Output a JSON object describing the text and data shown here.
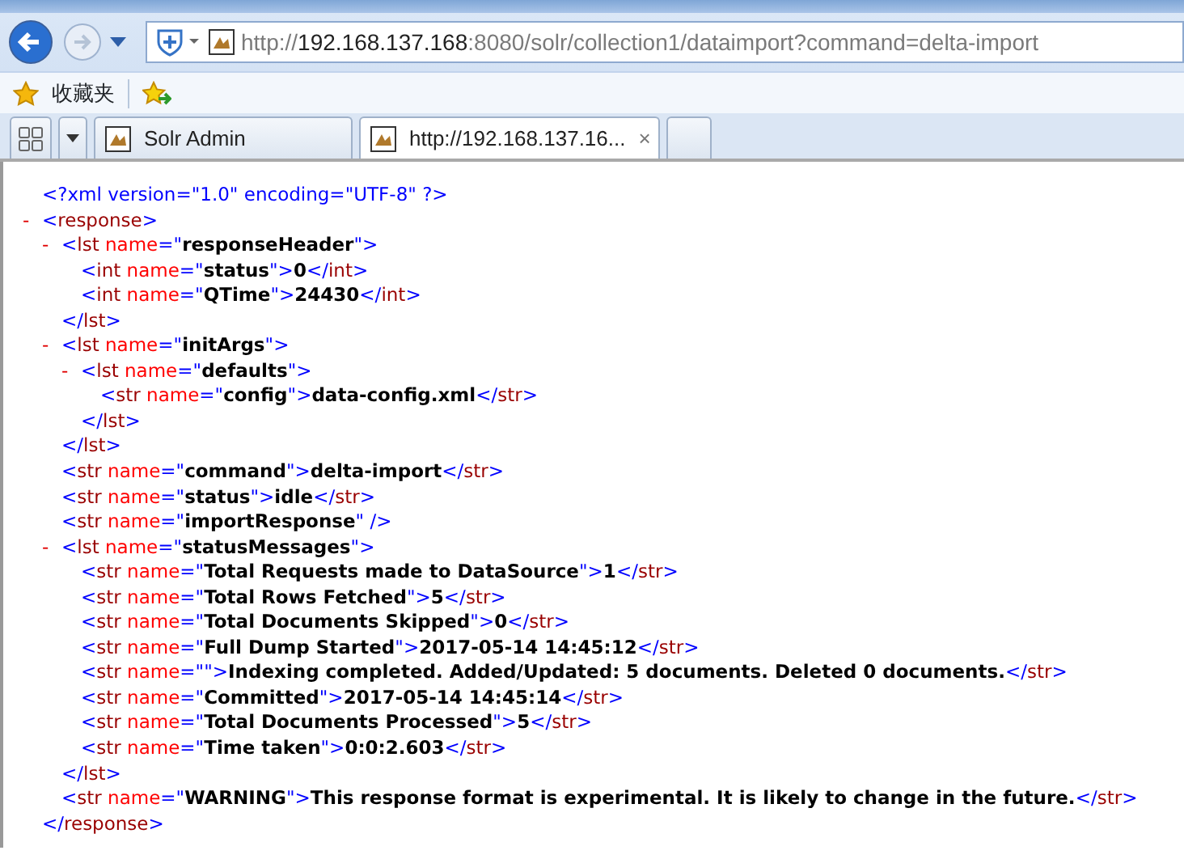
{
  "address_bar": {
    "url": {
      "scheme": "http://",
      "host": "192.168.137.168",
      "rest": ":8080/solr/collection1/dataimport?command=delta-import"
    }
  },
  "favorites_bar": {
    "label": "收藏夹"
  },
  "tabs": [
    {
      "label": "Solr Admin",
      "selected": false
    },
    {
      "label": "http://192.168.137.16...",
      "selected": true,
      "close": "×"
    }
  ],
  "xml_view": {
    "syntax": {
      "lt": "<",
      "lt_close": "</",
      "gt": ">",
      "self_end": " />",
      "eq": "=",
      "quote": "\"",
      "toggle": "-"
    },
    "declaration": "<?xml version=\"1.0\" encoding=\"UTF-8\" ?>",
    "root": {
      "kind": "element",
      "tag": "response",
      "close_tag": "response",
      "expanded": true,
      "children": [
        {
          "kind": "element",
          "tag": "lst",
          "close_tag": "lst",
          "attr": "name",
          "attr_value": "responseHeader",
          "expanded": true,
          "children": [
            {
              "kind": "leaf",
              "tag": "int",
              "close_tag": "int",
              "attr": "name",
              "attr_value": "status",
              "text": "0"
            },
            {
              "kind": "leaf",
              "tag": "int",
              "close_tag": "int",
              "attr": "name",
              "attr_value": "QTime",
              "text": "24430"
            }
          ]
        },
        {
          "kind": "element",
          "tag": "lst",
          "close_tag": "lst",
          "attr": "name",
          "attr_value": "initArgs",
          "expanded": true,
          "children": [
            {
              "kind": "element",
              "tag": "lst",
              "close_tag": "lst",
              "attr": "name",
              "attr_value": "defaults",
              "expanded": true,
              "children": [
                {
                  "kind": "leaf",
                  "tag": "str",
                  "close_tag": "str",
                  "attr": "name",
                  "attr_value": "config",
                  "text": "data-config.xml"
                }
              ]
            }
          ]
        },
        {
          "kind": "leaf",
          "tag": "str",
          "close_tag": "str",
          "attr": "name",
          "attr_value": "command",
          "text": "delta-import"
        },
        {
          "kind": "leaf",
          "tag": "str",
          "close_tag": "str",
          "attr": "name",
          "attr_value": "status",
          "text": "idle"
        },
        {
          "kind": "empty",
          "tag": "str",
          "attr": "name",
          "attr_value": "importResponse"
        },
        {
          "kind": "element",
          "tag": "lst",
          "close_tag": "lst",
          "attr": "name",
          "attr_value": "statusMessages",
          "expanded": true,
          "children": [
            {
              "kind": "leaf",
              "tag": "str",
              "close_tag": "str",
              "attr": "name",
              "attr_value": "Total Requests made to DataSource",
              "text": "1"
            },
            {
              "kind": "leaf",
              "tag": "str",
              "close_tag": "str",
              "attr": "name",
              "attr_value": "Total Rows Fetched",
              "text": "5"
            },
            {
              "kind": "leaf",
              "tag": "str",
              "close_tag": "str",
              "attr": "name",
              "attr_value": "Total Documents Skipped",
              "text": "0"
            },
            {
              "kind": "leaf",
              "tag": "str",
              "close_tag": "str",
              "attr": "name",
              "attr_value": "Full Dump Started",
              "text": "2017-05-14 14:45:12"
            },
            {
              "kind": "leaf",
              "tag": "str",
              "close_tag": "str",
              "attr": "name",
              "text": "Indexing completed. Added/Updated: 5 documents. Deleted 0 documents."
            },
            {
              "kind": "leaf",
              "tag": "str",
              "close_tag": "str",
              "attr": "name",
              "attr_value": "Committed",
              "text": "2017-05-14 14:45:14"
            },
            {
              "kind": "leaf",
              "tag": "str",
              "close_tag": "str",
              "attr": "name",
              "attr_value": "Total Documents Processed",
              "text": "5"
            },
            {
              "kind": "leaf",
              "tag": "str",
              "close_tag": "str",
              "attr": "name",
              "attr_value": "Time taken",
              "text": "0:0:2.603"
            }
          ]
        },
        {
          "kind": "leaf",
          "tag": "str",
          "close_tag": "str",
          "attr": "name",
          "attr_value": "WARNING",
          "text": "This response format is experimental. It is likely to change in the future."
        }
      ]
    }
  }
}
